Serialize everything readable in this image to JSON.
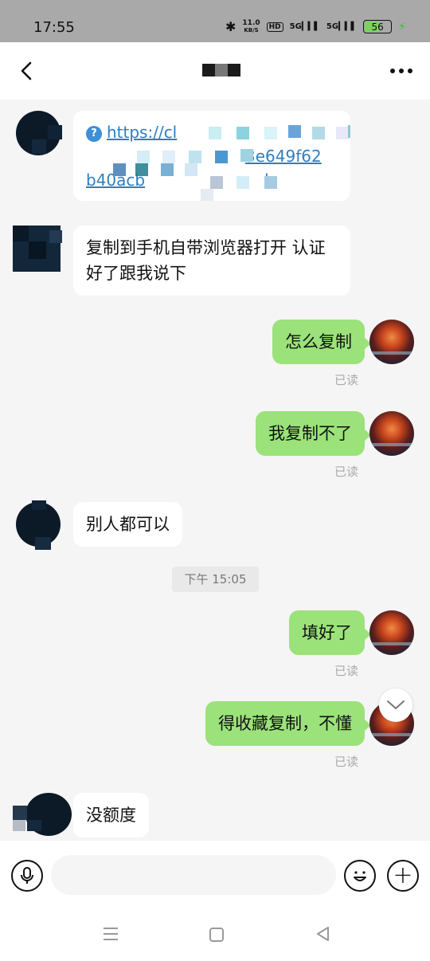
{
  "status_bar": {
    "time": "17:55",
    "speed_value": "11.0",
    "speed_unit": "KB/S",
    "hd_badge": "HD",
    "signal_1": "5G",
    "signal_2": "5G",
    "battery": "56"
  },
  "header": {
    "title": "",
    "back_icon": "chevron-left-icon",
    "more_icon": "more-horizontal-icon"
  },
  "messages": [
    {
      "side": "left",
      "type": "link",
      "link_text": "https://cl",
      "link_line2_fragment": "3e649f62",
      "link_line3_fragment": "b40acb",
      "link_line3_end": "b"
    },
    {
      "side": "left",
      "type": "text",
      "text": "复制到手机自带浏览器打开   认证好了跟我说下"
    },
    {
      "side": "right",
      "type": "text",
      "text": "怎么复制",
      "status": "已读"
    },
    {
      "side": "right",
      "type": "text",
      "text": "我复制不了",
      "status": "已读"
    },
    {
      "side": "left",
      "type": "text",
      "text": "别人都可以"
    },
    {
      "side": "time",
      "text": "下午 15:05"
    },
    {
      "side": "right",
      "type": "text",
      "text": "填好了",
      "status": "已读"
    },
    {
      "side": "right",
      "type": "text",
      "text": "得收藏复制，不懂",
      "status": "已读"
    },
    {
      "side": "left",
      "type": "text",
      "text": "没额度"
    }
  ],
  "input_bar": {
    "placeholder": "",
    "voice_icon": "microphone-icon",
    "emoji_icon": "emoji-icon",
    "plus_icon": "plus-icon"
  },
  "nav_bar": {
    "menu_icon": "menu-icon",
    "home_icon": "home-icon",
    "back_icon": "back-triangle-icon"
  },
  "colors": {
    "bubble_right": "#9be27a",
    "bubble_left": "#ffffff",
    "link": "#2e7fc0",
    "read_text": "#aaaaaa"
  }
}
